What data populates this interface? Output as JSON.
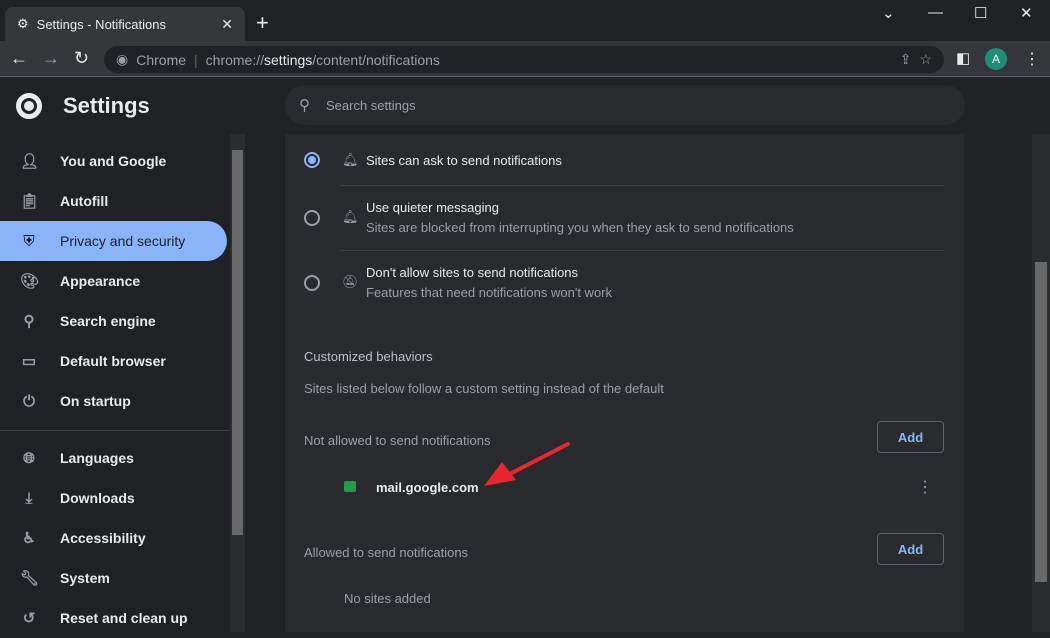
{
  "browser": {
    "tab_title": "Settings - Notifications",
    "omnibox_label": "Chrome",
    "url_prefix": "chrome://",
    "url_host": "settings",
    "url_path": "/content/notifications",
    "avatar_letter": "A"
  },
  "header": {
    "title": "Settings",
    "search_placeholder": "Search settings"
  },
  "sidebar": {
    "items": [
      {
        "label": "You and Google",
        "icon": "person-icon"
      },
      {
        "label": "Autofill",
        "icon": "clipboard-icon"
      },
      {
        "label": "Privacy and security",
        "icon": "shield-icon",
        "selected": true
      },
      {
        "label": "Appearance",
        "icon": "palette-icon"
      },
      {
        "label": "Search engine",
        "icon": "search-icon"
      },
      {
        "label": "Default browser",
        "icon": "browser-icon"
      },
      {
        "label": "On startup",
        "icon": "power-icon"
      },
      {
        "label": "Languages",
        "icon": "globe-icon"
      },
      {
        "label": "Downloads",
        "icon": "download-icon"
      },
      {
        "label": "Accessibility",
        "icon": "accessibility-icon"
      },
      {
        "label": "System",
        "icon": "wrench-icon"
      },
      {
        "label": "Reset and clean up",
        "icon": "history-icon"
      }
    ]
  },
  "options": [
    {
      "title": "Sites can ask to send notifications",
      "selected": true
    },
    {
      "title": "Use quieter messaging",
      "subtitle": "Sites are blocked from interrupting you when they ask to send notifications"
    },
    {
      "title": "Don't allow sites to send notifications",
      "subtitle": "Features that need notifications won't work"
    }
  ],
  "custom": {
    "heading": "Customized behaviors",
    "description": "Sites listed below follow a custom setting instead of the default",
    "blocked_label": "Not allowed to send notifications",
    "blocked_sites": [
      "mail.google.com"
    ],
    "allowed_label": "Allowed to send notifications",
    "allowed_empty": "No sites added",
    "add_label": "Add"
  },
  "colors": {
    "accent": "#8ab4f8",
    "annotation_arrow": "#e8262b"
  }
}
